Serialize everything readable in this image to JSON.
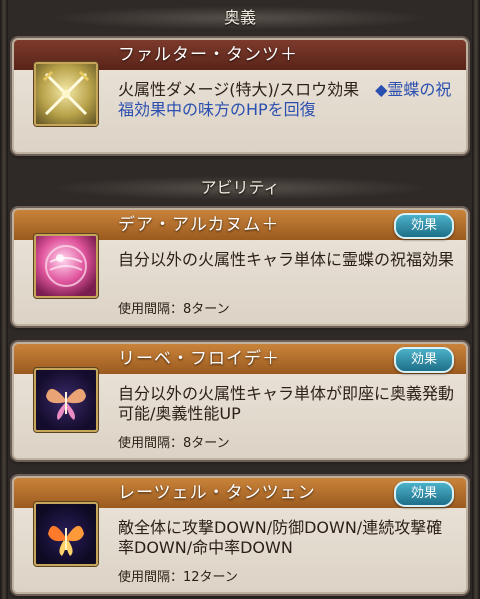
{
  "headers": {
    "ougi": "奥義",
    "abilities": "アビリティ"
  },
  "ougi": {
    "name": "ファルター・タンツ＋",
    "desc_main": "火属性ダメージ(特大)/スロウ効果　",
    "desc_highlight": "◆霊蝶の祝福効果中の味方のHPを回復",
    "icon": "crossed-swords-icon"
  },
  "abilities": [
    {
      "name": "デア・アルカヌム＋",
      "effect_label": "効果",
      "desc": "自分以外の火属性キャラ単体に霊蝶の祝福効果",
      "cooldown": "使用間隔：8ターン",
      "icon": "pink-orb-icon"
    },
    {
      "name": "リーベ・フロイデ＋",
      "effect_label": "効果",
      "desc": "自分以外の火属性キャラ単体が即座に奥義発動可能/奥義性能UP",
      "cooldown": "使用間隔：8ターン",
      "icon": "butterfly-icon"
    },
    {
      "name": "レーツェル・タンツェン",
      "effect_label": "効果",
      "desc": "敵全体に攻撃DOWN/防御DOWN/連続攻撃確率DOWN/命中率DOWN",
      "cooldown": "使用間隔：12ターン",
      "icon": "flame-butterfly-icon"
    }
  ],
  "colors": {
    "ougi_bar": "#6b2f23",
    "ability_bar": "#b36f2c",
    "highlight_text": "#2a4fb0",
    "effect_button": "#2f8fa8"
  }
}
